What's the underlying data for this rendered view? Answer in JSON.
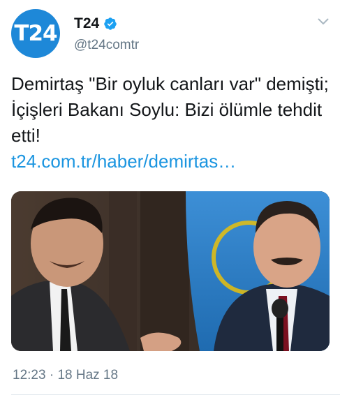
{
  "account": {
    "avatar_text": "T24",
    "display_name": "T24",
    "handle": "@t24comtr",
    "verified": true,
    "brand_color": "#1e88d8"
  },
  "tweet": {
    "text": "Demirtaş \"Bir oyluk canları var\" demişti; İçişleri Bakanı Soylu: Bizi ölümle tehdit etti!",
    "link": "t24.com.tr/haber/demirtas…",
    "time": "12:23",
    "separator": "·",
    "date": "18 Haz 18"
  },
  "media": {
    "description_icon": "photo-two-men-icon"
  },
  "colors": {
    "link": "#1b95e0",
    "muted": "#657786",
    "text": "#14171a",
    "verified": "#1da1f2"
  }
}
